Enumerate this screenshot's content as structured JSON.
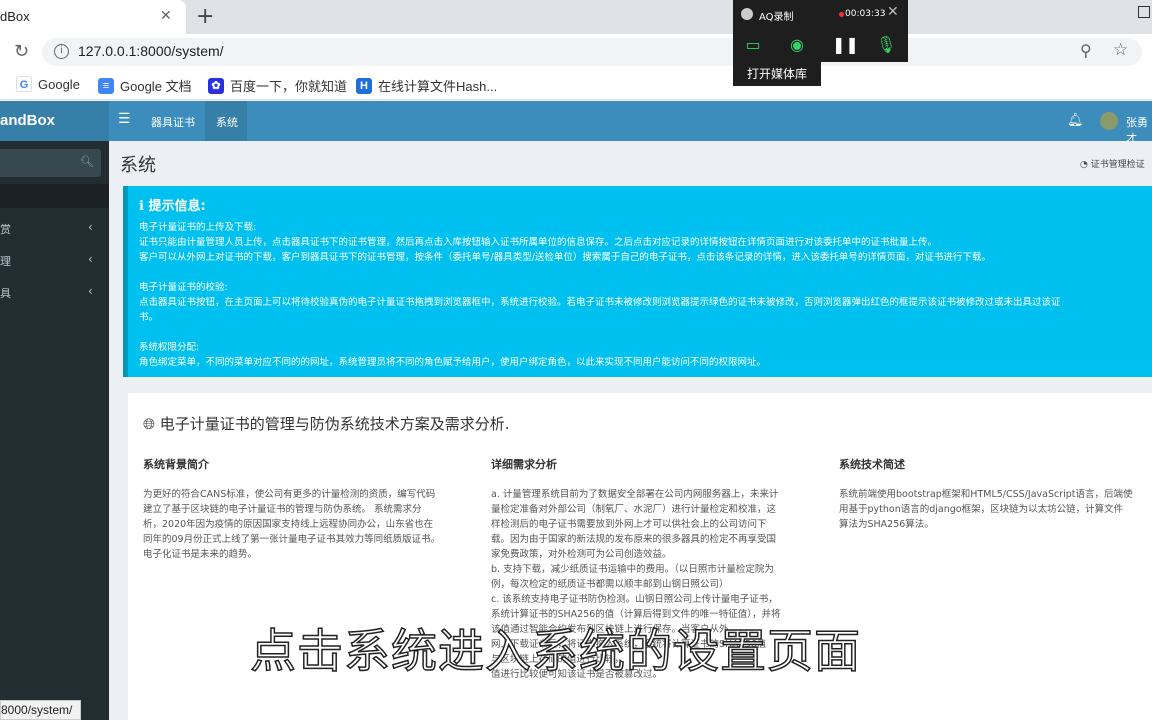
{
  "browser": {
    "tab_title": "dBox",
    "url": "127.0.0.1:8000/system/",
    "status_url": "8000/system/",
    "bookmarks": [
      {
        "label": "Google",
        "icon": "google-icon"
      },
      {
        "label": "Google 文档",
        "icon": "docs-icon"
      },
      {
        "label": "百度一下，你就知道",
        "icon": "baidu-icon"
      },
      {
        "label": "在线计算文件Hash...",
        "icon": "hash-icon"
      }
    ]
  },
  "recorder": {
    "title": "AQ录制",
    "time": "00:03:33",
    "tooltip": "打开媒体库"
  },
  "app": {
    "logo": "andBox",
    "nav": [
      "器具证书",
      "系统"
    ],
    "username": "张勇才",
    "sidebar": [
      "赏",
      "理",
      "具"
    ]
  },
  "page": {
    "title": "系统",
    "breadcrumb": "证书管理检证"
  },
  "callout": {
    "title": "提示信息:",
    "lines": [
      "电子计量证书的上传及下载:",
      "证书只能由计量管理人员上传，点击器具证书下的证书管理，然后再点击入库按钮输入证书所属单位的信息保存。之后点击对应记录的详情按钮在详情页面进行对该委托单中的证书批量上传。",
      "客户可以从外网上对证书的下载，客户到器具证书下的证书管理，按条件（委托单号/器具类型/送检单位）搜索属于自己的电子证书，点击该条记录的详情，进入该委托单号的详情页面，对证书进行下载。",
      "",
      "电子计量证书的校验:",
      "点击器具证书按钮，在主页面上可以将待校验真伪的电子计量证书拖拽到浏览器框中，系统进行校验。若电子证书未被修改则浏览器提示绿色的证书未被修改，否则浏览器弹出红色的框提示该证书被修改过或未出具过该证",
      "书。",
      "",
      "系统权限分配:",
      "角色绑定菜单，不同的菜单对应不同的的网址，系统管理员将不同的角色赋予给用户，使用户绑定角色，以此来实现不同用户能访问不同的权限网址。"
    ]
  },
  "section": {
    "title": "电子计量证书的管理与防伪系统技术方案及需求分析.",
    "columns": [
      {
        "heading": "系统背景简介",
        "lines": [
          "为更好的符合CANS标准，使公司有更多的计量检测的资质，编写代码",
          "建立了基于区块链的电子计量证书的管理与防伪系统。 系统需求分",
          "析，2020年因为疫情的原因国家支持线上远程协同办公，山东省也在",
          "同年的09月份正式上线了第一张计量电子证书其效力等同纸质版证书。",
          "电子化证书是未来的趋势。"
        ]
      },
      {
        "heading": "详细需求分析",
        "lines": [
          "a. 计量管理系统目前为了数据安全部署在公司内网服务器上，未来计",
          "量检定准备对外部公司（制氧厂、水泥厂）进行计量检定和校准，这",
          "样检测后的电子证书需要放到外网上才可以供社会上的公司访问下",
          "载。因为由于国家的新法规的发布原来的很多器具的检定不再享受国",
          "家免费政策，对外检测可为公司创造效益。",
          "b. 支持下载，减少纸质证书运输中的费用。（以日照市计量检定院为",
          "例，每次检定的纸质证书都需以顺丰邮到山钢日照公司）",
          "c. 该系统支持电子证书防伪检测。山钢日照公司上传计量电子证书，",
          "系统计算证书的SHA256的值（计算后得到文件的唯一特征值），并将",
          "该值通过智能合约发布到区块链上进行保存。当客户从外",
          "网上下载证书后，将证书拖入系统，系统将计算证书的SHA256值",
          "与区块链上存储的值进行比较，",
          "值进行比较便可知该证书是否被篡改过。"
        ]
      },
      {
        "heading": "系统技术简述",
        "lines": [
          "系统前端使用bootstrap框架和HTML5/CSS/JavaScript语言，后端使",
          "用基于python语言的django框架，区块链为以太坊公链，计算文件",
          "算法为SHA256算法。"
        ]
      }
    ]
  },
  "subtitle": "点击系统进入系统的设置页面",
  "colors": {
    "header": "#3c8dbc",
    "sidebar": "#222d32",
    "callout": "#00c0ef"
  }
}
